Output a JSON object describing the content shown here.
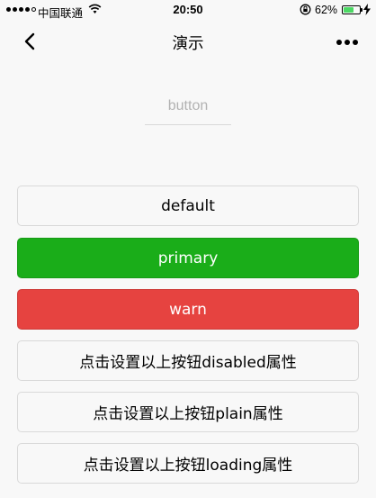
{
  "status_bar": {
    "carrier": "中国联通",
    "time": "20:50",
    "battery_percent": "62%",
    "battery_level": 0.62,
    "icons": [
      "signal-dots-icon",
      "wifi-icon",
      "rotation-lock-icon",
      "battery-icon",
      "charging-icon"
    ]
  },
  "nav": {
    "title": "演示",
    "back_icon": "chevron-left-icon",
    "more_icon": "more-dots-icon"
  },
  "input": {
    "value": "",
    "placeholder": "button"
  },
  "buttons": {
    "default": "default",
    "primary": "primary",
    "warn": "warn",
    "toggle_disabled": "点击设置以上按钮disabled属性",
    "toggle_plain": "点击设置以上按钮plain属性",
    "toggle_loading": "点击设置以上按钮loading属性"
  },
  "colors": {
    "primary": "#1aad19",
    "warn": "#e64340",
    "background": "#f8f8f8"
  }
}
